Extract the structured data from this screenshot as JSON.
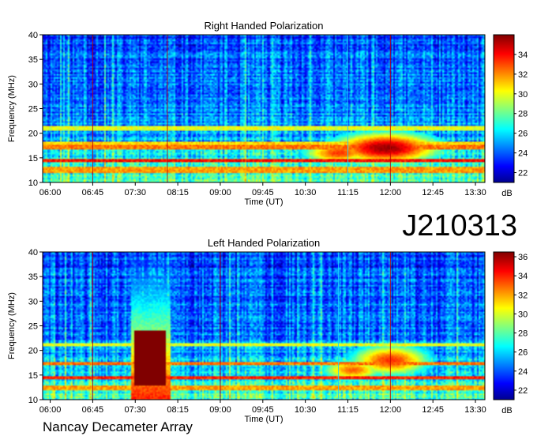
{
  "header": {
    "observation_id": "J210313",
    "footer": "Nancay Decameter Array"
  },
  "chart_data": [
    {
      "type": "heatmap",
      "title": "Right Handed Polarization",
      "xlabel": "Time (UT)",
      "ylabel": "Frequency (MHz)",
      "x_ticks": [
        "06:00",
        "06:45",
        "07:30",
        "08:15",
        "09:00",
        "09:45",
        "10:30",
        "11:15",
        "12:00",
        "12:45",
        "13:30"
      ],
      "y_ticks": [
        10,
        15,
        20,
        25,
        30,
        35,
        40
      ],
      "xlim": [
        "05:52",
        "13:40"
      ],
      "ylim": [
        10,
        40
      ],
      "colorbar": {
        "label": "dB",
        "ticks": [
          22,
          24,
          26,
          28,
          30,
          32,
          34
        ],
        "range": [
          21,
          36
        ]
      },
      "features": [
        {
          "kind": "hband",
          "freq": [
            12.0,
            13.2
          ],
          "level": 0.78
        },
        {
          "kind": "hband",
          "freq": [
            14.0,
            14.8
          ],
          "level": 0.92
        },
        {
          "kind": "hband",
          "freq": [
            16.8,
            17.6
          ],
          "level": 0.82
        },
        {
          "kind": "hband",
          "freq": [
            17.8,
            18.4
          ],
          "level": 0.72
        },
        {
          "kind": "hband",
          "freq": [
            20.6,
            21.6
          ],
          "level": 0.66
        },
        {
          "kind": "blob",
          "time": "11:55",
          "freq": 17.0,
          "dt": 55,
          "df": 3.0,
          "level": 0.95
        },
        {
          "kind": "blob",
          "time": "11:05",
          "freq": 16.0,
          "dt": 35,
          "df": 2.0,
          "level": 0.8
        },
        {
          "kind": "vline",
          "time": "06:45",
          "level": 0.9
        },
        {
          "kind": "vline",
          "time": "08:04",
          "level": 0.9
        },
        {
          "kind": "vline",
          "time": "11:15",
          "level": 0.7
        },
        {
          "kind": "vline",
          "time": "12:00",
          "level": 0.9
        }
      ]
    },
    {
      "type": "heatmap",
      "title": "Left Handed Polarization",
      "xlabel": "Time (UT)",
      "ylabel": "Frequency (MHz)",
      "x_ticks": [
        "06:00",
        "06:45",
        "07:30",
        "08:15",
        "09:00",
        "09:45",
        "10:30",
        "11:15",
        "12:00",
        "12:45",
        "13:30"
      ],
      "y_ticks": [
        10,
        15,
        20,
        25,
        30,
        35,
        40
      ],
      "xlim": [
        "05:52",
        "13:40"
      ],
      "ylim": [
        10,
        40
      ],
      "colorbar": {
        "label": "dB",
        "ticks": [
          22,
          24,
          26,
          28,
          30,
          32,
          34,
          36
        ],
        "range": [
          21,
          36.5
        ]
      },
      "features": [
        {
          "kind": "hband",
          "freq": [
            12.0,
            13.0
          ],
          "level": 0.78
        },
        {
          "kind": "hband",
          "freq": [
            14.0,
            14.8
          ],
          "level": 0.9
        },
        {
          "kind": "hband",
          "freq": [
            17.0,
            17.8
          ],
          "level": 0.82
        },
        {
          "kind": "hband",
          "freq": [
            21.0,
            21.6
          ],
          "level": 0.66
        },
        {
          "kind": "burst",
          "time": [
            "07:29",
            "08:03"
          ],
          "freq": [
            13.0,
            24.0
          ],
          "level": 1.0
        },
        {
          "kind": "burst_halo",
          "time": [
            "07:25",
            "08:08"
          ],
          "freq": [
            10.0,
            40.0
          ],
          "level": 0.5
        },
        {
          "kind": "blob",
          "time": "12:00",
          "freq": 18.0,
          "dt": 40,
          "df": 3.0,
          "level": 0.8
        },
        {
          "kind": "blob",
          "time": "11:20",
          "freq": 16.0,
          "dt": 30,
          "df": 2.0,
          "level": 0.75
        },
        {
          "kind": "vline",
          "time": "06:45",
          "level": 0.9
        },
        {
          "kind": "vline",
          "time": "09:00",
          "level": 0.9
        },
        {
          "kind": "vline",
          "time": "11:05",
          "level": 0.65
        },
        {
          "kind": "vline",
          "time": "12:00",
          "level": 0.9
        }
      ]
    }
  ]
}
